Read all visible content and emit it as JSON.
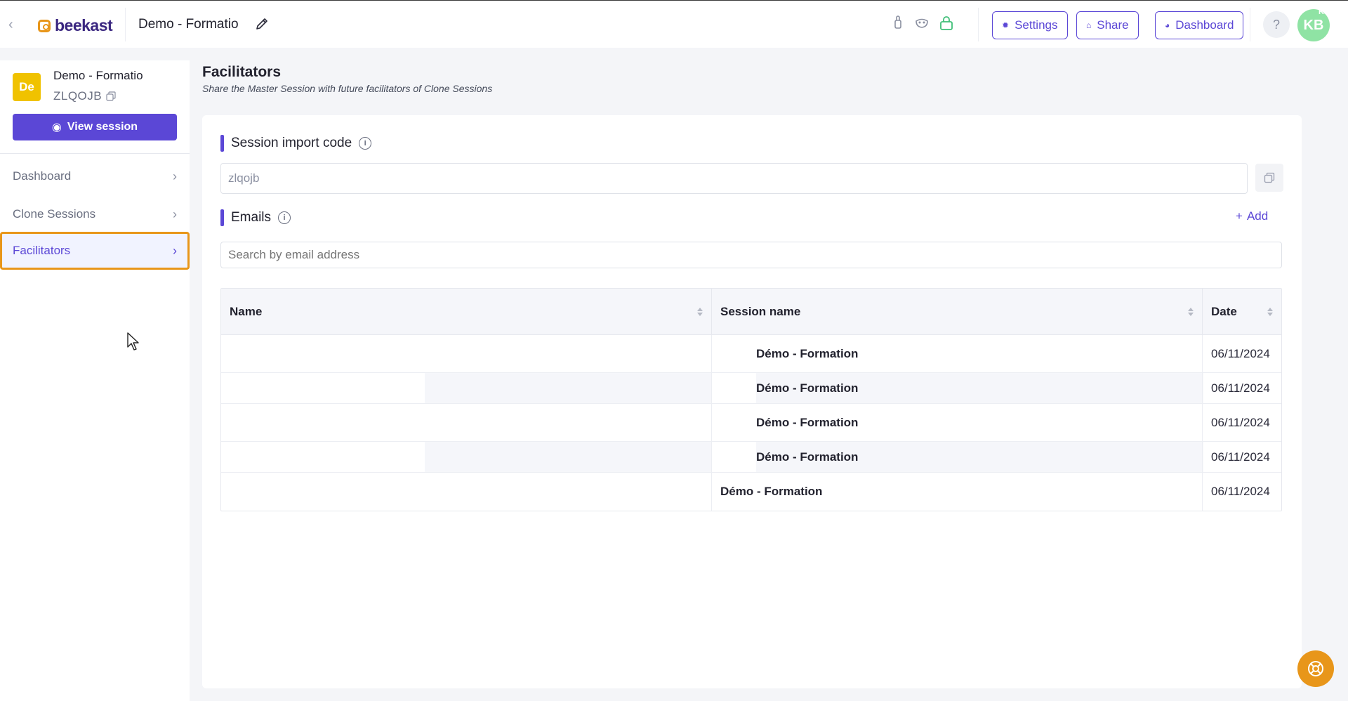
{
  "topbar": {
    "logo_text": "beekast",
    "session_title": "Demo - Formatio",
    "settings_label": "Settings",
    "share_label": "Share",
    "dashboard_label": "Dashboard",
    "help_label": "?",
    "avatar_initials": "KB",
    "avatar_badge": "KB",
    "icons": [
      "back-chevron",
      "pencil-icon",
      "hand-icon",
      "mask-icon",
      "lock-icon"
    ]
  },
  "sidebar": {
    "avatar_initials": "De",
    "session_name": "Demo - Formatio",
    "session_code": "ZLQOJB",
    "view_button_label": "View session",
    "items": [
      {
        "label": "Dashboard",
        "active": false
      },
      {
        "label": "Clone Sessions",
        "active": false
      },
      {
        "label": "Facilitators",
        "active": true
      }
    ]
  },
  "main": {
    "title": "Facilitators",
    "subtitle": "Share the Master Session with future facilitators of Clone Sessions",
    "import_section": {
      "heading": "Session import code",
      "code_value": "zlqojb"
    },
    "emails_section": {
      "heading": "Emails",
      "add_label": "Add",
      "search_placeholder": "Search by email address"
    },
    "table": {
      "columns": [
        "Name",
        "Session name",
        "Date"
      ],
      "rows": [
        {
          "name": "",
          "session_name": "Démo - Formation",
          "date": "06/11/2024"
        },
        {
          "name": "",
          "session_name": "Démo - Formation",
          "date": "06/11/2024"
        },
        {
          "name": "",
          "session_name": "Démo - Formation",
          "date": "06/11/2024"
        },
        {
          "name": "",
          "session_name": "Démo - Formation",
          "date": "06/11/2024"
        },
        {
          "name": "",
          "session_name": "Démo - Formation",
          "date": "06/11/2024"
        }
      ]
    }
  },
  "colors": {
    "accent": "#5b47d6",
    "brand_orange": "#e8961a",
    "avatar_green": "#8fe3a4",
    "session_avatar_yellow": "#f0c200"
  }
}
